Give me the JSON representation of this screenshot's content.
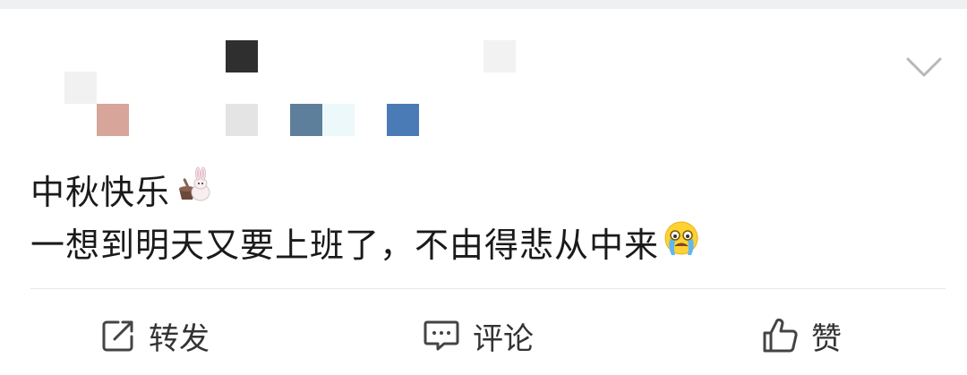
{
  "header": {
    "redacted_mosaic": [
      {
        "color": "#f1f1f1"
      },
      {
        "color": "#2f2f2f"
      },
      {
        "color": "#f2f2f2"
      },
      {
        "color": "#d7a59a"
      },
      {
        "color": "#e4e4e4"
      },
      {
        "color": "#5d7f9c"
      },
      {
        "color": "#edf8fb"
      },
      {
        "color": "#4a7bb7"
      }
    ],
    "menu_icon": "chevron-down-icon"
  },
  "post": {
    "line1": "中秋快乐",
    "line1_emoji": "rabbit-mochi-emoji",
    "line2": "一想到明天又要上班了，不由得悲从中来",
    "line2_emoji": "crying-face-emoji"
  },
  "actions": {
    "repost": {
      "label": "转发",
      "icon": "share-icon"
    },
    "comment": {
      "label": "评论",
      "icon": "comment-icon"
    },
    "like": {
      "label": "赞",
      "icon": "thumbs-up-icon"
    }
  }
}
